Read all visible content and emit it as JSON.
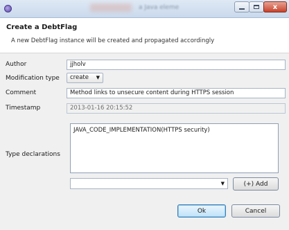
{
  "window": {
    "title": "a Java eleme",
    "controls": {
      "close_label": "x"
    }
  },
  "dialog": {
    "title": "Create a DebtFlag",
    "description": "A new DebtFlag instance will be created and propagated accordingly"
  },
  "form": {
    "author_label": "Author",
    "author_value": "jjholv",
    "modification_label": "Modification type",
    "modification_value": "create",
    "comment_label": "Comment",
    "comment_value": "Method links to unsecure content during HTTPS session",
    "timestamp_label": "Timestamp",
    "timestamp_value": "2013-01-16 20:15:52",
    "types_label": "Type declarations",
    "types": [
      "JAVA_CODE_IMPLEMENTATION(HTTPS security)"
    ],
    "type_select_value": "",
    "add_label": "(+) Add"
  },
  "buttons": {
    "ok": "Ok",
    "cancel": "Cancel"
  },
  "icons": {
    "app": "eclipse-icon",
    "minimize": "minimize-icon",
    "maximize": "maximize-icon",
    "close": "close-icon",
    "dropdown": "chevron-down-icon"
  }
}
